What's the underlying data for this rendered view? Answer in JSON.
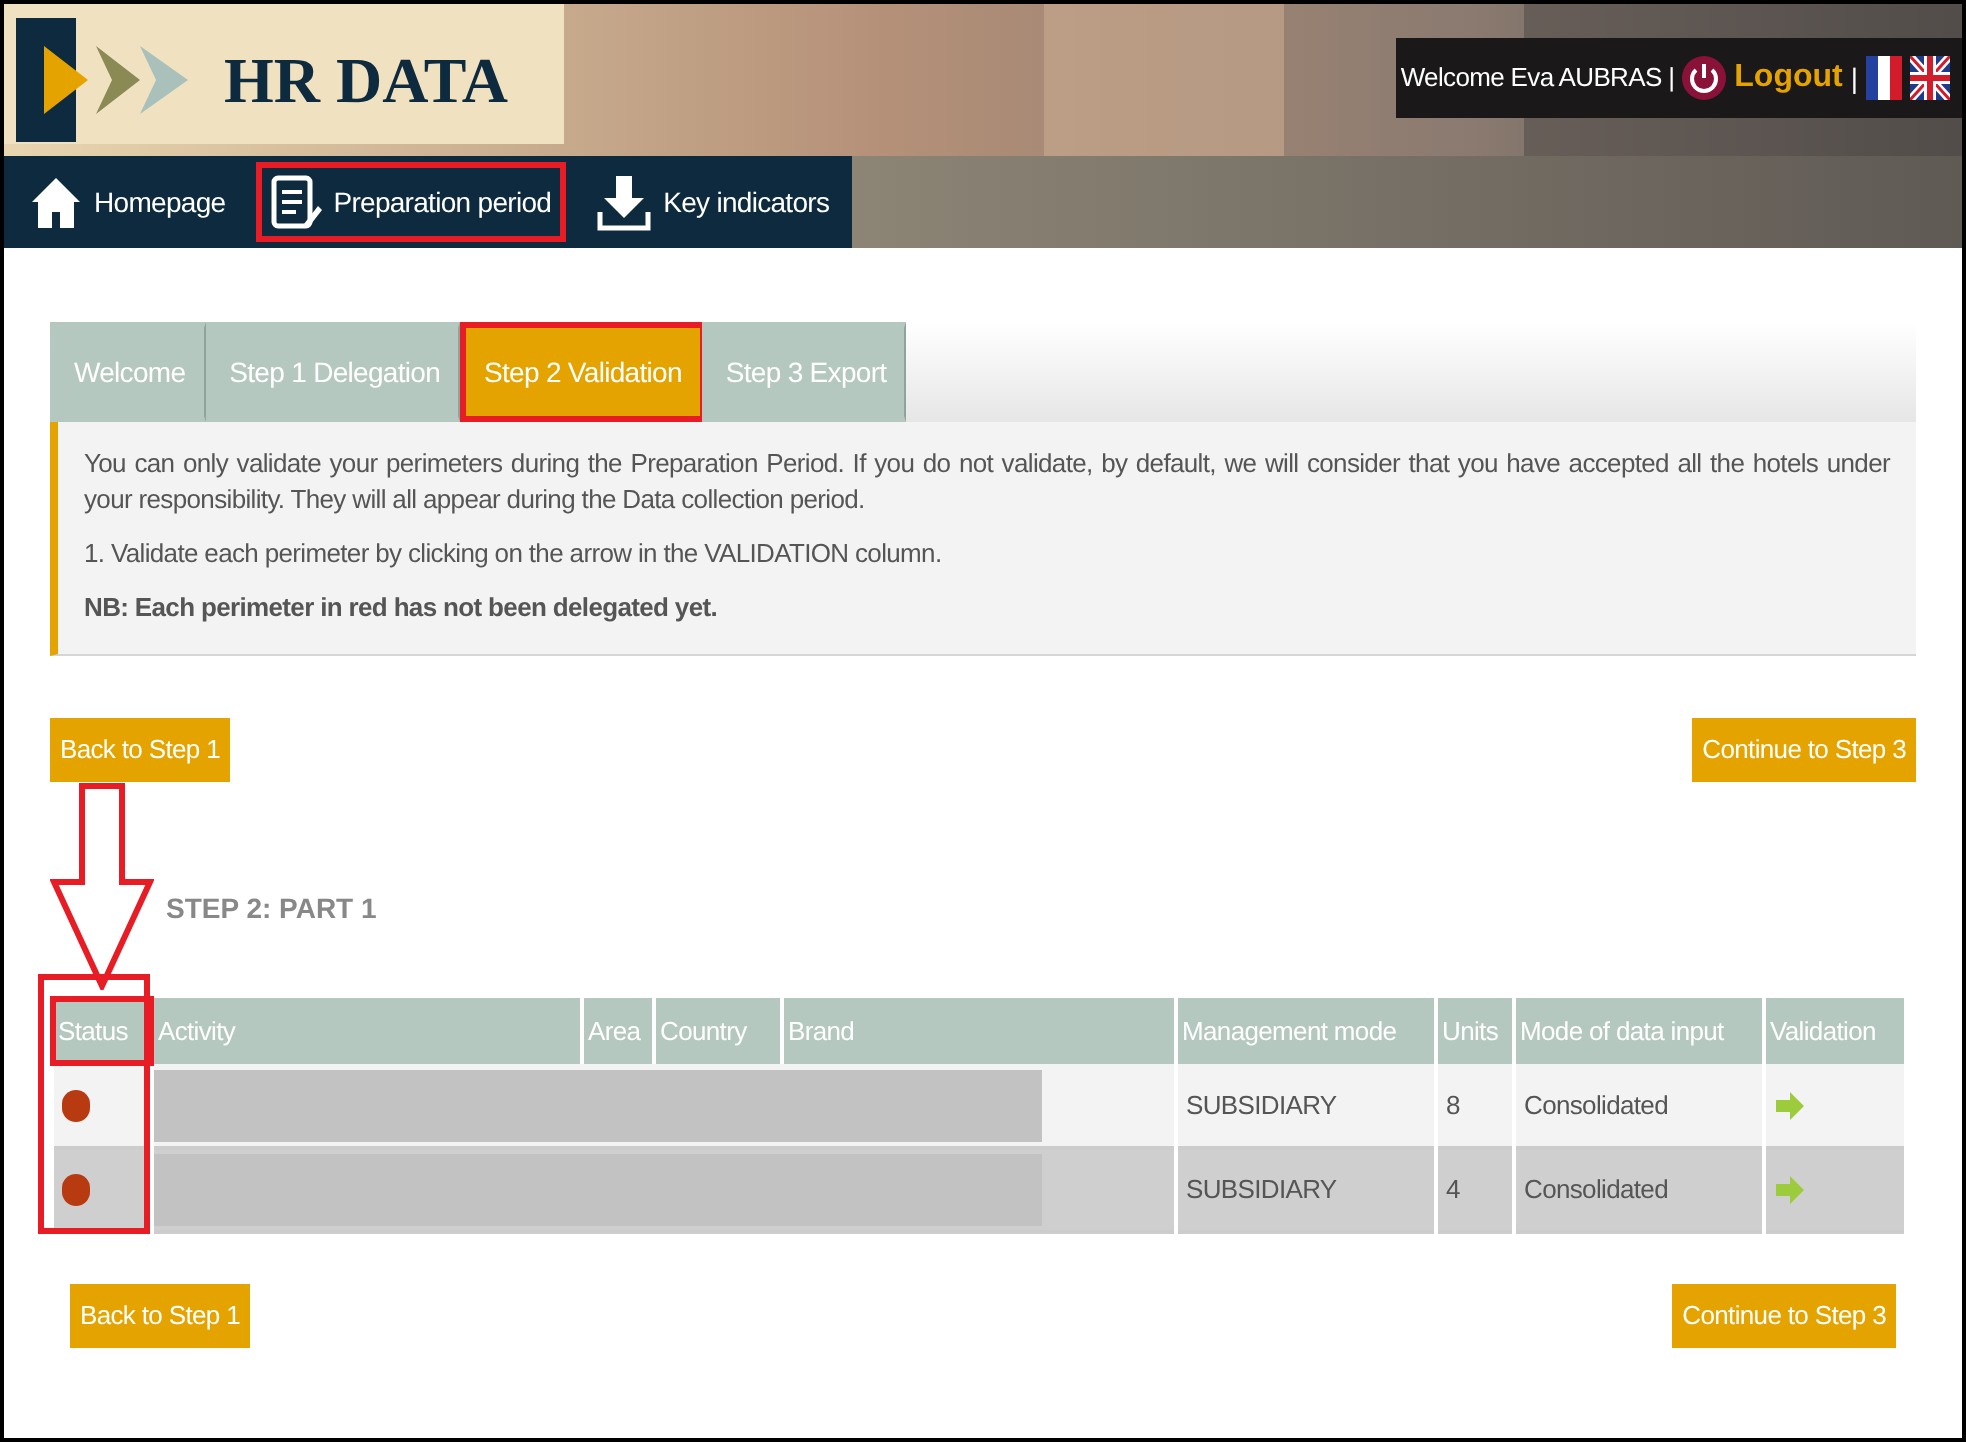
{
  "header": {
    "logo_text": "HR DATA",
    "welcome": "Welcome Eva AUBRAS |",
    "logout": "Logout",
    "separator": "|"
  },
  "nav": [
    {
      "label": "Homepage",
      "kind": "home",
      "highlighted": false
    },
    {
      "label": "Preparation period",
      "kind": "list",
      "highlighted": true
    },
    {
      "label": "Key indicators",
      "kind": "download",
      "highlighted": false
    }
  ],
  "tabs": [
    {
      "label": "Welcome",
      "selected": false,
      "highlighted": false
    },
    {
      "label": "Step 1 Delegation",
      "selected": false,
      "highlighted": false
    },
    {
      "label": "Step 2 Validation",
      "selected": true,
      "highlighted": true
    },
    {
      "label": "Step 3 Export",
      "selected": false,
      "highlighted": false
    }
  ],
  "info": {
    "paragraphs": [
      "You can only validate your perimeters during the Preparation Period. If you do not validate, by default, we will consider that you have accepted all the hotels under your responsibility. They will all appear during the Data collection period.",
      "1. Validate each perimeter by clicking on the arrow in the VALIDATION column.",
      "**NB: Each perimeter in red has not been delegated yet.**"
    ]
  },
  "top_buttons": {
    "back": "Back to Step 1",
    "continue": "Continue to Step 3"
  },
  "section_title": "STEP 2: PART 1",
  "table": {
    "columns": [
      {
        "label": "Status",
        "highlighted": true
      },
      {
        "label": "Activity",
        "highlighted": false
      },
      {
        "label": "Area",
        "highlighted": false
      },
      {
        "label": "Country",
        "highlighted": false
      },
      {
        "label": "Brand",
        "highlighted": false
      },
      {
        "label": "Management mode",
        "highlighted": false
      },
      {
        "label": "Units",
        "highlighted": false
      },
      {
        "label": "Mode of data input",
        "highlighted": false
      },
      {
        "label": "Validation",
        "highlighted": false
      }
    ],
    "rows": [
      {
        "color": "#b83a10",
        "management_mode": "SUBSIDIARY",
        "units": "8",
        "mode_of_data_input": "Consolidated"
      },
      {
        "color": "#b83a10",
        "management_mode": "SUBSIDIARY",
        "units": "4",
        "mode_of_data_input": "Consolidated"
      }
    ]
  },
  "bottom_buttons": {
    "back": "Back to Step 1",
    "continue": "Continue to Step 3"
  }
}
